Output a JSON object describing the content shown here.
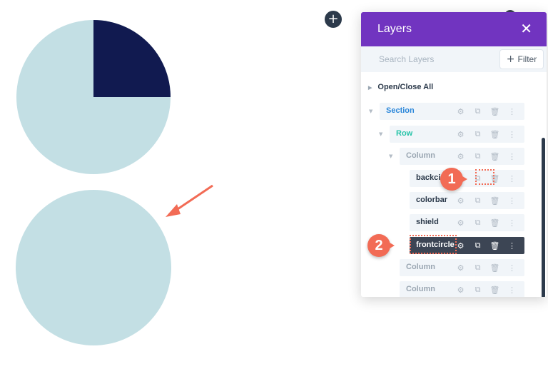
{
  "panel": {
    "title": "Layers",
    "close_label": "✕",
    "search_placeholder": "Search Layers",
    "filter_label": "Filter",
    "filter_icon": "+"
  },
  "tree": {
    "open_close_label": "Open/Close All",
    "items": [
      {
        "label": "Section",
        "level": 0,
        "color": "#2b87da"
      },
      {
        "label": "Row",
        "level": 1,
        "color": "#29c4a9"
      },
      {
        "label": "Column",
        "level": 2,
        "color": "#9aa6b2"
      },
      {
        "label": "backcircle",
        "visible_label": "backcir",
        "level": 3,
        "color": "#2c3a4b"
      },
      {
        "label": "colorbar",
        "level": 3,
        "color": "#2c3a4b"
      },
      {
        "label": "shield",
        "level": 3,
        "color": "#2c3a4b"
      },
      {
        "label": "frontcircle",
        "level": 3,
        "color": "#ffffff",
        "selected": true
      },
      {
        "label": "Column",
        "level": 2,
        "color": "#9aa6b2"
      },
      {
        "label": "Column",
        "level": 2,
        "color": "#9aa6b2"
      }
    ]
  },
  "canvas": {
    "add_button_label": "+",
    "pie_fill_fraction": 0.25,
    "colors": {
      "light": "#c3dfe4",
      "dark": "#111a50",
      "accent": "#f26b55",
      "panel_purple": "#7134c0"
    }
  },
  "callouts": [
    {
      "number": "1"
    },
    {
      "number": "2"
    }
  ]
}
